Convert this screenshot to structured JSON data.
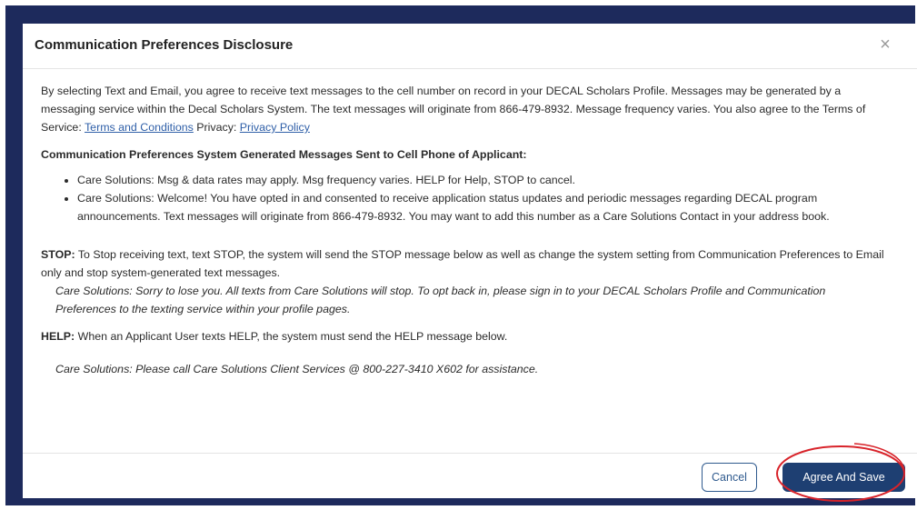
{
  "modal": {
    "title": "Communication Preferences Disclosure",
    "close_glyph": "×",
    "intro": {
      "text_before_terms": "By selecting Text and Email, you agree to receive text messages to the cell number on record in your DECAL Scholars Profile. Messages may be generated by a messaging service within the Decal Scholars System. The text messages will originate from 866-479-8932. Message frequency varies. You also agree to the Terms of Service: ",
      "terms_link": "Terms and Conditions",
      "text_between": " Privacy: ",
      "privacy_link": "Privacy Policy"
    },
    "section_title": "Communication Preferences System Generated Messages Sent to Cell Phone of Applicant:",
    "bullets": [
      "Care Solutions: Msg & data rates may apply. Msg frequency varies. HELP for Help, STOP to cancel.",
      "Care Solutions: Welcome! You have opted in and consented to receive application status updates and periodic messages regarding DECAL program announcements. Text messages will originate from 866-479-8932. You may want to add this number as a Care Solutions Contact in your address book."
    ],
    "stop": {
      "label": "STOP:",
      "text": " To Stop receiving text, text STOP, the system will send the STOP message below as well as change the system setting from Communication Preferences to Email only and stop system-generated text messages.",
      "message": "Care Solutions: Sorry to lose you. All texts from Care Solutions will stop. To opt back in, please sign in to your DECAL Scholars Profile and Communication Preferences to the texting service within your profile pages."
    },
    "help": {
      "label": "HELP:",
      "text": " When an Applicant User texts HELP, the system must send the HELP message below.",
      "message": "Care Solutions: Please call Care Solutions Client Services @ 800-227-3410 X602 for assistance."
    },
    "footer": {
      "cancel_label": "Cancel",
      "agree_label": "Agree And Save"
    }
  },
  "colors": {
    "backdrop": "#1d2a5c",
    "primary_button": "#1e3f72",
    "link": "#2f5fa8",
    "annotation": "#d8232a"
  }
}
